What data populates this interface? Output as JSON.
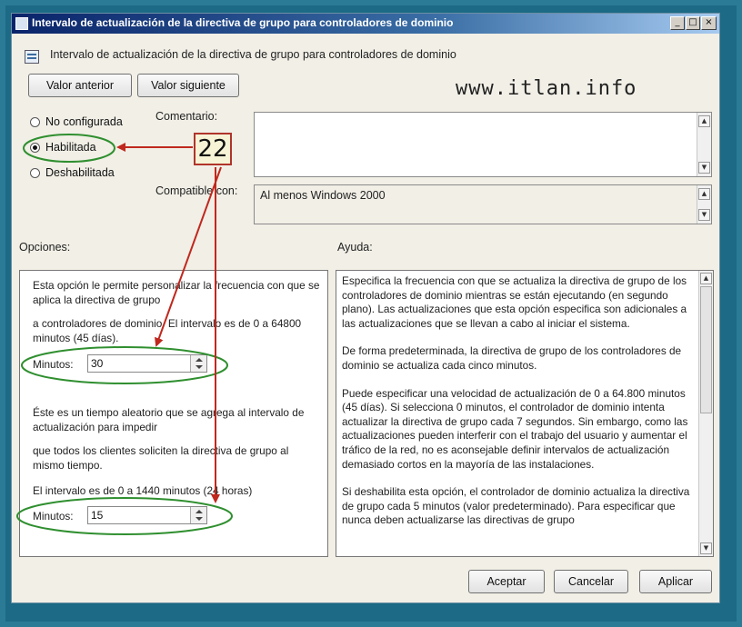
{
  "window": {
    "title": "Intervalo de actualización de la directiva de grupo para controladores de dominio",
    "controls": {
      "minimize": "_",
      "maximize": "□",
      "close": "×"
    }
  },
  "header": {
    "icon": "policy-icon",
    "title": "Intervalo de actualización de la directiva de grupo para controladores de dominio"
  },
  "nav": {
    "prev": "Valor anterior",
    "next": "Valor siguiente"
  },
  "watermark": "www.itlan.info",
  "state": {
    "options": [
      {
        "label": "No configurada",
        "selected": false
      },
      {
        "label": "Habilitada",
        "selected": true
      },
      {
        "label": "Deshabilitada",
        "selected": false
      }
    ]
  },
  "comment": {
    "label": "Comentario:",
    "value": ""
  },
  "supported": {
    "label": "Compatible con:",
    "value": "Al menos Windows 2000"
  },
  "sections": {
    "options": "Opciones:",
    "help": "Ayuda:"
  },
  "options_panel": {
    "p1": "Esta opción le permite personalizar la frecuencia con que se aplica la directiva de grupo",
    "p2": "a controladores de dominio. El intervalo es de 0 a 64800 minutos (45 días).",
    "minutes1_label": "Minutos:",
    "minutes1_value": "30",
    "p3": "Éste es un tiempo aleatorio que se agrega al intervalo de actualización para impedir",
    "p4": "que todos los clientes soliciten la directiva de grupo al mismo tiempo.",
    "p5": "El intervalo es de 0 a 1440 minutos (24 horas)",
    "minutes2_label": "Minutos:",
    "minutes2_value": "15"
  },
  "help_panel": {
    "p1": "Especifica la frecuencia con que se actualiza la directiva de grupo de los controladores de dominio mientras se están ejecutando (en segundo plano). Las actualizaciones que esta opción especifica son adicionales a las actualizaciones que se llevan a cabo al iniciar el sistema.",
    "p2": "De forma predeterminada, la directiva de grupo de los controladores de dominio se actualiza cada cinco minutos.",
    "p3": "Puede especificar una velocidad de actualización de 0 a 64.800 minutos (45 días). Si selecciona 0 minutos, el controlador de dominio intenta actualizar la directiva de grupo cada 7 segundos. Sin embargo, como las actualizaciones pueden interferir con el trabajo del usuario y aumentar el tráfico de la red, no es aconsejable definir intervalos de actualización demasiado cortos en la mayoría de las instalaciones.",
    "p4": "Si deshabilita esta opción, el controlador de dominio actualiza la directiva de grupo cada 5 minutos (valor predeterminado). Para especificar que nunca deben actualizarse las directivas de grupo"
  },
  "footer": {
    "ok": "Aceptar",
    "cancel": "Cancelar",
    "apply": "Aplicar"
  },
  "annotation": {
    "callout": "22"
  },
  "colors": {
    "arrow": "#c0281e",
    "ellipse": "#2f8f2f",
    "title_start": "#0a246a",
    "title_end": "#a6caf0"
  }
}
